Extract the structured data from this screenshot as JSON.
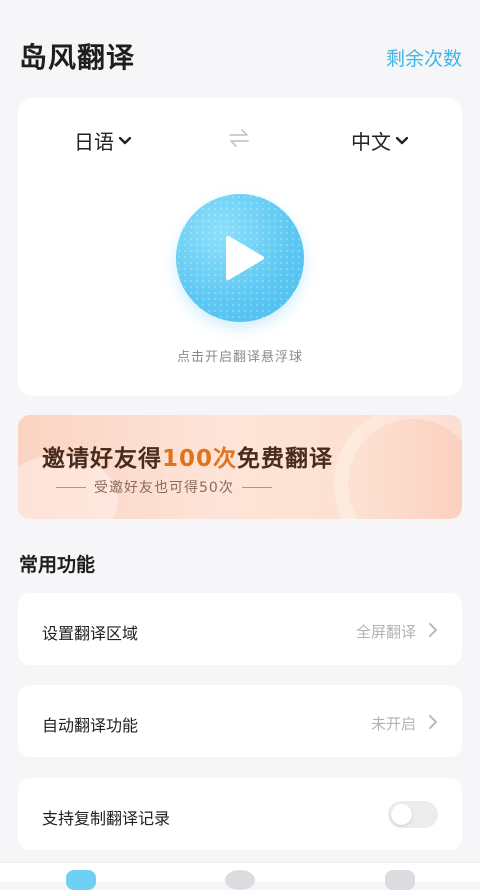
{
  "header": {
    "title": "岛风翻译",
    "remain_label": "剩余次数"
  },
  "translator": {
    "source_lang": "日语",
    "target_lang": "中文",
    "hint": "点击开启翻译悬浮球"
  },
  "banner": {
    "title_prefix": "邀请好友得",
    "title_highlight": "100次",
    "title_suffix": "免费翻译",
    "subtitle": "受邀好友也可得50次"
  },
  "features": {
    "title": "常用功能",
    "items": [
      {
        "label": "设置翻译区域",
        "value": "全屏翻译"
      },
      {
        "label": "自动翻译功能",
        "value": "未开启"
      },
      {
        "label": "支持复制翻译记录",
        "toggle_on": false
      }
    ]
  },
  "colors": {
    "accent": "#3bb8e8",
    "play": "#5fc9f3",
    "banner_highlight": "#e0731c"
  }
}
